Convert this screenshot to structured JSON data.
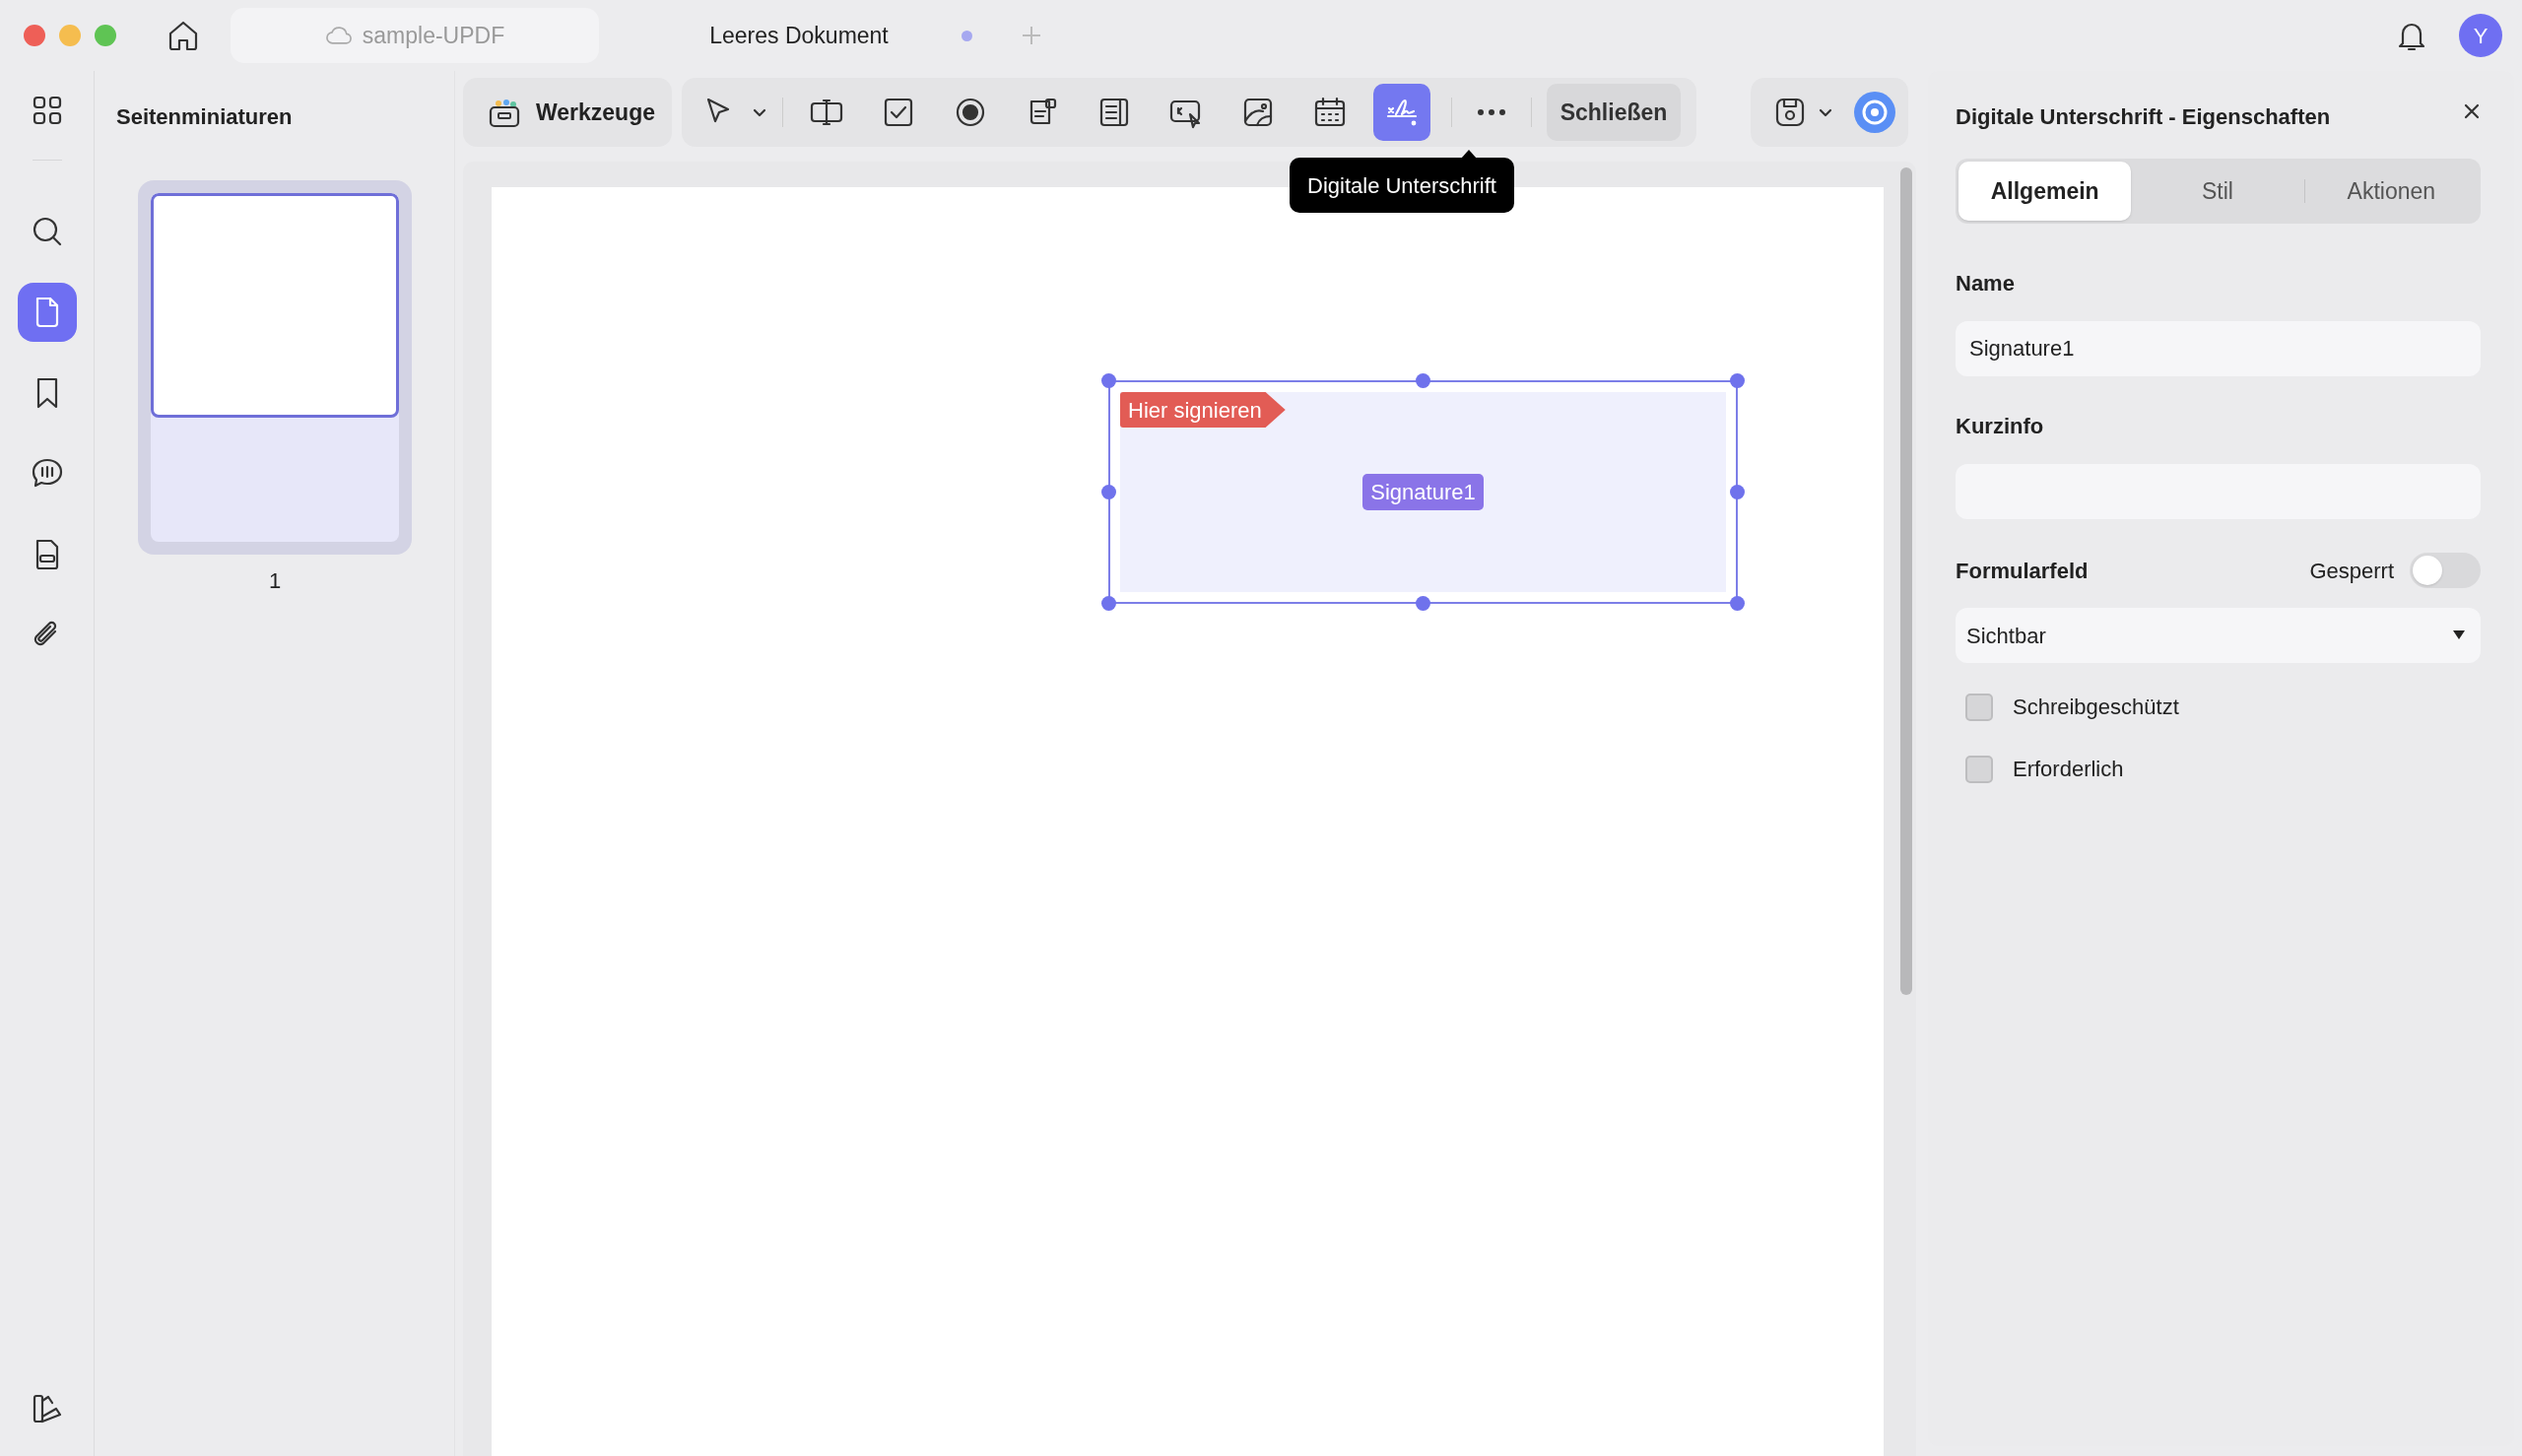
{
  "window": {
    "tabs": [
      {
        "label": "sample-UPDF",
        "selected": false
      },
      {
        "label": "Leeres Dokument",
        "selected": true
      }
    ],
    "unsaved": true,
    "avatar": "Y"
  },
  "rail": [
    {
      "kind": "grid",
      "selected": false
    },
    {
      "kind": "search",
      "selected": false
    },
    {
      "kind": "pages",
      "selected": true
    },
    {
      "kind": "bookmark",
      "selected": false
    },
    {
      "kind": "comment",
      "selected": false
    },
    {
      "kind": "form",
      "selected": false
    },
    {
      "kind": "attachment",
      "selected": false
    }
  ],
  "thumbnails": {
    "title": "Seitenminiaturen",
    "pages": [
      {
        "label": "1",
        "selected": true
      }
    ]
  },
  "toolbar": {
    "tools_button": "Werkzeuge",
    "tools": [
      {
        "kind": "select",
        "selected": false
      },
      {
        "kind": "textfield",
        "selected": false
      },
      {
        "kind": "checkbox",
        "selected": false
      },
      {
        "kind": "radio",
        "selected": false
      },
      {
        "kind": "combo",
        "selected": false
      },
      {
        "kind": "list",
        "selected": false
      },
      {
        "kind": "button",
        "selected": false
      },
      {
        "kind": "image",
        "selected": false
      },
      {
        "kind": "date",
        "selected": false
      },
      {
        "kind": "signature",
        "selected": true
      }
    ],
    "close_button": "Schließen",
    "tooltip": "Digitale Unterschrift"
  },
  "document": {
    "field": {
      "badge": "Hier signieren",
      "name": "Signature1",
      "selected": true
    }
  },
  "panel": {
    "title": "Digitale Unterschrift - Eigenschaften",
    "tabs": [
      {
        "label": "Allgemein",
        "selected": true
      },
      {
        "label": "Stil",
        "selected": false
      },
      {
        "label": "Aktionen",
        "selected": false
      }
    ],
    "name_label": "Name",
    "name_value": "Signature1",
    "info_label": "Kurzinfo",
    "form_field_label": "Formularfeld",
    "locked_label": "Gesperrt",
    "locked": false,
    "visibility": "Sichtbar",
    "checkboxes": [
      {
        "label": "Schreibgeschützt",
        "checked": false
      },
      {
        "label": "Erforderlich",
        "checked": false
      }
    ]
  }
}
